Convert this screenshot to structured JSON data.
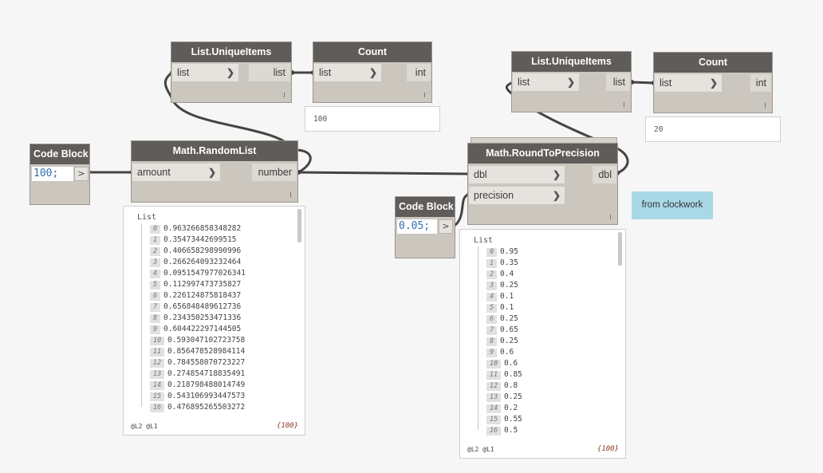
{
  "left_group": {
    "unique_items": {
      "title": "List.UniqueItems",
      "input": "list",
      "output": "list"
    },
    "count": {
      "title": "Count",
      "input": "list",
      "output": "int",
      "preview": "100"
    },
    "code_block": {
      "title": "Code Block",
      "code": "100;",
      "output": ">"
    },
    "random_list": {
      "title": "Math.RandomList",
      "input": "amount",
      "output": "number",
      "watch": {
        "list_label": "List",
        "items": [
          {
            "index": "0",
            "value": "0.963266858348282"
          },
          {
            "index": "1",
            "value": "0.35473442699515"
          },
          {
            "index": "2",
            "value": "0.406658298990996"
          },
          {
            "index": "3",
            "value": "0.266264093232464"
          },
          {
            "index": "4",
            "value": "0.0951547977026341"
          },
          {
            "index": "5",
            "value": "0.112997473735827"
          },
          {
            "index": "6",
            "value": "0.226124875818437"
          },
          {
            "index": "7",
            "value": "0.656848489612736"
          },
          {
            "index": "8",
            "value": "0.234350253471336"
          },
          {
            "index": "9",
            "value": "0.604422297144505"
          },
          {
            "index": "10",
            "value": "0.593047102723758"
          },
          {
            "index": "11",
            "value": "0.856478528984114"
          },
          {
            "index": "12",
            "value": "0.784558070723227"
          },
          {
            "index": "13",
            "value": "0.274854718835491"
          },
          {
            "index": "14",
            "value": "0.218798488014749"
          },
          {
            "index": "15",
            "value": "0.543106993447573"
          },
          {
            "index": "16",
            "value": "0.476895265503272"
          }
        ],
        "levels": "@L2 @L1",
        "count": "{100}"
      }
    }
  },
  "right_group": {
    "unique_items": {
      "title": "List.UniqueItems",
      "input": "list",
      "output": "list"
    },
    "count": {
      "title": "Count",
      "input": "list",
      "output": "int",
      "preview": "20"
    },
    "code_block": {
      "title": "Code Block",
      "code": "0.05;",
      "output": ">"
    },
    "round_to_precision": {
      "title": "Math.RoundToPrecision",
      "inputs": [
        "dbl",
        "precision"
      ],
      "output": "dbl",
      "watch": {
        "list_label": "List",
        "items": [
          {
            "index": "0",
            "value": "0.95"
          },
          {
            "index": "1",
            "value": "0.35"
          },
          {
            "index": "2",
            "value": "0.4"
          },
          {
            "index": "3",
            "value": "0.25"
          },
          {
            "index": "4",
            "value": "0.1"
          },
          {
            "index": "5",
            "value": "0.1"
          },
          {
            "index": "6",
            "value": "0.25"
          },
          {
            "index": "7",
            "value": "0.65"
          },
          {
            "index": "8",
            "value": "0.25"
          },
          {
            "index": "9",
            "value": "0.6"
          },
          {
            "index": "10",
            "value": "0.6"
          },
          {
            "index": "11",
            "value": "0.85"
          },
          {
            "index": "12",
            "value": "0.8"
          },
          {
            "index": "13",
            "value": "0.25"
          },
          {
            "index": "14",
            "value": "0.2"
          },
          {
            "index": "15",
            "value": "0.55"
          },
          {
            "index": "16",
            "value": "0.5"
          }
        ],
        "levels": "@L2 @L1",
        "count": "{100}"
      }
    },
    "note": "from clockwork"
  },
  "colors": {
    "canvas": "#f6f6f6",
    "node_header": "#5f5c59",
    "node_body": "#cbc6be",
    "wire": "#3f3f3f",
    "note": "#a9d8e6",
    "code_text": "#2f6fb0"
  }
}
